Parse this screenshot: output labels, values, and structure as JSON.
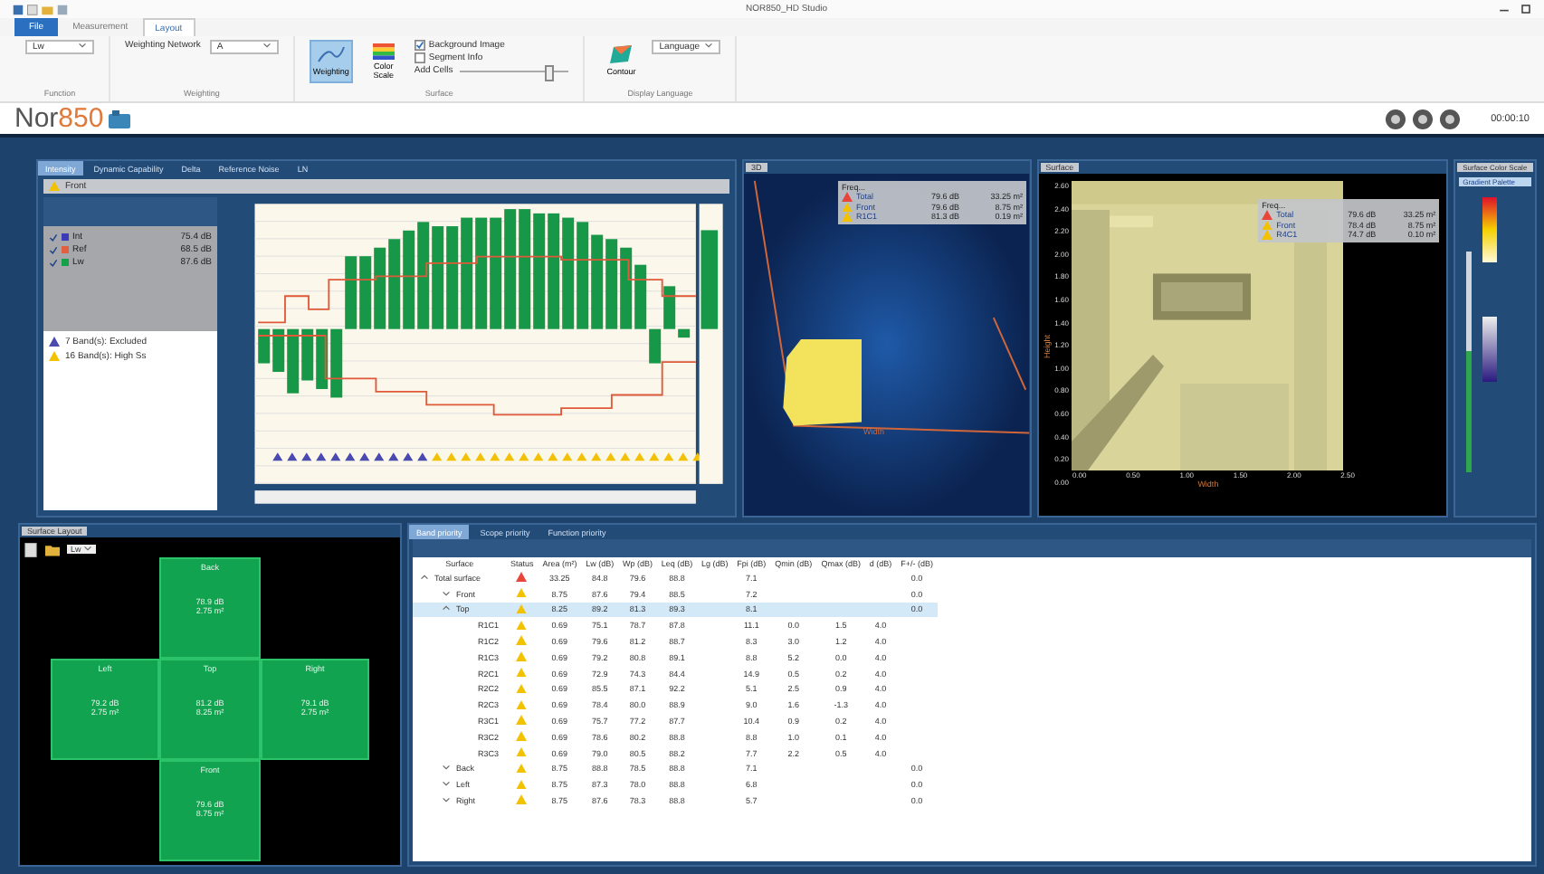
{
  "window": {
    "title": "NOR850_HD Studio"
  },
  "menu_tabs": [
    {
      "label": "File",
      "selected": false,
      "kind": "file"
    },
    {
      "label": "Measurement",
      "selected": false,
      "kind": "tab"
    },
    {
      "label": "Layout",
      "selected": true,
      "kind": "tab"
    }
  ],
  "ribbon": {
    "function_value": "Lw",
    "weighting_label": "Weighting Network",
    "weighting_value": "A",
    "buttons": [
      {
        "label": "Weighting",
        "selected": true,
        "kind": "curve"
      },
      {
        "label": "Color Scale",
        "selected": false,
        "kind": "scale"
      }
    ],
    "checks": [
      {
        "label": "Background Image",
        "checked": true
      },
      {
        "label": "Segment Info",
        "checked": false
      }
    ],
    "slider_label": "Add Cells",
    "slider": {
      "level": 0.8
    },
    "contour_label": "Contour",
    "language": "Language",
    "groups": [
      "Function",
      "Weighting",
      "Surface",
      "Display Language"
    ]
  },
  "logo": {
    "name": "Nor",
    "number": "850"
  },
  "timer": "00:00:10",
  "analysis": {
    "tabs": [
      {
        "label": "Intensity",
        "selected": true
      },
      {
        "label": "Dynamic Capability",
        "selected": false
      },
      {
        "label": "Delta",
        "selected": false
      },
      {
        "label": "Reference Noise",
        "selected": false
      },
      {
        "label": "LN",
        "selected": false
      }
    ],
    "header": "Front",
    "legend": [
      {
        "label": "Int",
        "value": "75.4 dB",
        "checked": true,
        "color": "#3b3bb8"
      },
      {
        "label": "Ref",
        "value": "68.5 dB",
        "checked": true,
        "color": "#e06040"
      },
      {
        "label": "Lw",
        "value": "87.6 dB",
        "checked": true,
        "color": "#17a04a"
      }
    ],
    "warnings": [
      {
        "text": "7 Band(s): Excluded",
        "kind": "excluded"
      },
      {
        "text": "16 Band(s): High Ss",
        "kind": "high"
      }
    ]
  },
  "view3d": {
    "tab": "3D",
    "info_title": "Freq...",
    "axis": "Width",
    "rows": [
      {
        "name": "Total",
        "value": "79.6 dB",
        "area": "33.25 m²",
        "kind": "error"
      },
      {
        "name": "Front",
        "value": "79.6 dB",
        "area": "8.75 m²",
        "kind": "warning"
      },
      {
        "name": "R1C1",
        "value": "81.3 dB",
        "area": "0.19 m²",
        "kind": "warning"
      }
    ]
  },
  "surface": {
    "tab": "Surface",
    "info_title": "Freq...",
    "xlabel": "Width",
    "ylabel": "Height",
    "yticks": [
      "2.60",
      "2.40",
      "2.20",
      "2.00",
      "1.80",
      "1.60",
      "1.40",
      "1.20",
      "1.00",
      "0.80",
      "0.60",
      "0.40",
      "0.20",
      "0.00"
    ],
    "xticks": [
      "0.00",
      "0.50",
      "1.00",
      "1.50",
      "2.00",
      "2.50"
    ],
    "rows": [
      {
        "name": "Total",
        "value": "79.6 dB",
        "area": "33.25 m²",
        "kind": "error"
      },
      {
        "name": "Front",
        "value": "78.4 dB",
        "area": "8.75 m²",
        "kind": "warning"
      },
      {
        "name": "R4C1",
        "value": "74.7 dB",
        "area": "0.10 m²",
        "kind": "warning"
      }
    ]
  },
  "color_scale": {
    "title": "Surface Color Scale",
    "palette": "Gradient Palette",
    "range": {
      "level": 0.55
    }
  },
  "layout_panel": {
    "tab": "Surface Layout",
    "select": "Lw",
    "faces": [
      {
        "name": "Back",
        "value": "78.9 dB",
        "area": "2.75 m²",
        "kind": "top"
      },
      {
        "name": "Left",
        "value": "79.2 dB",
        "area": "2.75 m²",
        "kind": "left"
      },
      {
        "name": "Top",
        "value": "81.2 dB",
        "area": "8.25 m²",
        "kind": "center"
      },
      {
        "name": "Right",
        "value": "79.1 dB",
        "area": "2.75 m²",
        "kind": "right"
      },
      {
        "name": "Front",
        "value": "79.6 dB",
        "area": "8.75 m²",
        "kind": "bottom"
      }
    ]
  },
  "table": {
    "tabs": [
      {
        "label": "Band priority",
        "selected": true
      },
      {
        "label": "Scope priority",
        "selected": false
      },
      {
        "label": "Function priority",
        "selected": false
      }
    ],
    "columns": [
      "Surface",
      "Status",
      "Area (m²)",
      "Lw (dB)",
      "Wp (dB)",
      "Leq (dB)",
      "Lg (dB)",
      "Fpi (dB)",
      "Qmin (dB)",
      "Qmax (dB)",
      "d (dB)",
      "F+/- (dB)"
    ],
    "rows": [
      {
        "kind": "error",
        "cells": [
          "Total surface",
          "",
          "33.25",
          "84.8",
          "79.6",
          "88.8",
          "",
          "7.1",
          "",
          "",
          "",
          "0.0"
        ],
        "expanded": true,
        "selected": false,
        "children": [
          {
            "kind": "warning",
            "cells": [
              "Front",
              "",
              "8.75",
              "87.6",
              "79.4",
              "88.5",
              "",
              "7.2",
              "",
              "",
              "",
              "0.0"
            ],
            "expanded": false,
            "selected": false
          },
          {
            "kind": "warning",
            "cells": [
              "Top",
              "",
              "8.25",
              "89.2",
              "81.3",
              "89.3",
              "",
              "8.1",
              "",
              "",
              "",
              "0.0"
            ],
            "expanded": true,
            "selected": true,
            "children": [
              {
                "kind": "warning",
                "cells": [
                  "R1C1",
                  "",
                  "0.69",
                  "75.1",
                  "78.7",
                  "87.8",
                  "",
                  "11.1",
                  "0.0",
                  "1.5",
                  "4.0",
                  ""
                ]
              },
              {
                "kind": "warning",
                "cells": [
                  "R1C2",
                  "",
                  "0.69",
                  "79.6",
                  "81.2",
                  "88.7",
                  "",
                  "8.3",
                  "3.0",
                  "1.2",
                  "4.0",
                  ""
                ]
              },
              {
                "kind": "warning",
                "cells": [
                  "R1C3",
                  "",
                  "0.69",
                  "79.2",
                  "80.8",
                  "89.1",
                  "",
                  "8.8",
                  "5.2",
                  "0.0",
                  "4.0",
                  ""
                ]
              },
              {
                "kind": "warning",
                "cells": [
                  "R2C1",
                  "",
                  "0.69",
                  "72.9",
                  "74.3",
                  "84.4",
                  "",
                  "14.9",
                  "0.5",
                  "0.2",
                  "4.0",
                  ""
                ]
              },
              {
                "kind": "warning",
                "cells": [
                  "R2C2",
                  "",
                  "0.69",
                  "85.5",
                  "87.1",
                  "92.2",
                  "",
                  "5.1",
                  "2.5",
                  "0.9",
                  "4.0",
                  ""
                ]
              },
              {
                "kind": "warning",
                "cells": [
                  "R2C3",
                  "",
                  "0.69",
                  "78.4",
                  "80.0",
                  "88.9",
                  "",
                  "9.0",
                  "1.6",
                  "-1.3",
                  "4.0",
                  ""
                ]
              },
              {
                "kind": "warning",
                "cells": [
                  "R3C1",
                  "",
                  "0.69",
                  "75.7",
                  "77.2",
                  "87.7",
                  "",
                  "10.4",
                  "0.9",
                  "0.2",
                  "4.0",
                  ""
                ]
              },
              {
                "kind": "warning",
                "cells": [
                  "R3C2",
                  "",
                  "0.69",
                  "78.6",
                  "80.2",
                  "88.8",
                  "",
                  "8.8",
                  "1.0",
                  "0.1",
                  "4.0",
                  ""
                ]
              },
              {
                "kind": "warning",
                "cells": [
                  "R3C3",
                  "",
                  "0.69",
                  "79.0",
                  "80.5",
                  "88.2",
                  "",
                  "7.7",
                  "2.2",
                  "0.5",
                  "4.0",
                  ""
                ]
              }
            ]
          },
          {
            "kind": "warning",
            "cells": [
              "Back",
              "",
              "8.75",
              "88.8",
              "78.5",
              "88.8",
              "",
              "7.1",
              "",
              "",
              "",
              "0.0"
            ],
            "expanded": false,
            "selected": false
          },
          {
            "kind": "warning",
            "cells": [
              "Left",
              "",
              "8.75",
              "87.3",
              "78.0",
              "88.8",
              "",
              "6.8",
              "",
              "",
              "",
              "0.0"
            ],
            "expanded": false,
            "selected": false
          },
          {
            "kind": "warning",
            "cells": [
              "Right",
              "",
              "8.75",
              "87.6",
              "78.3",
              "88.8",
              "",
              "5.7",
              "",
              "",
              "",
              "0.0"
            ],
            "expanded": false,
            "selected": false
          }
        ]
      }
    ]
  }
}
